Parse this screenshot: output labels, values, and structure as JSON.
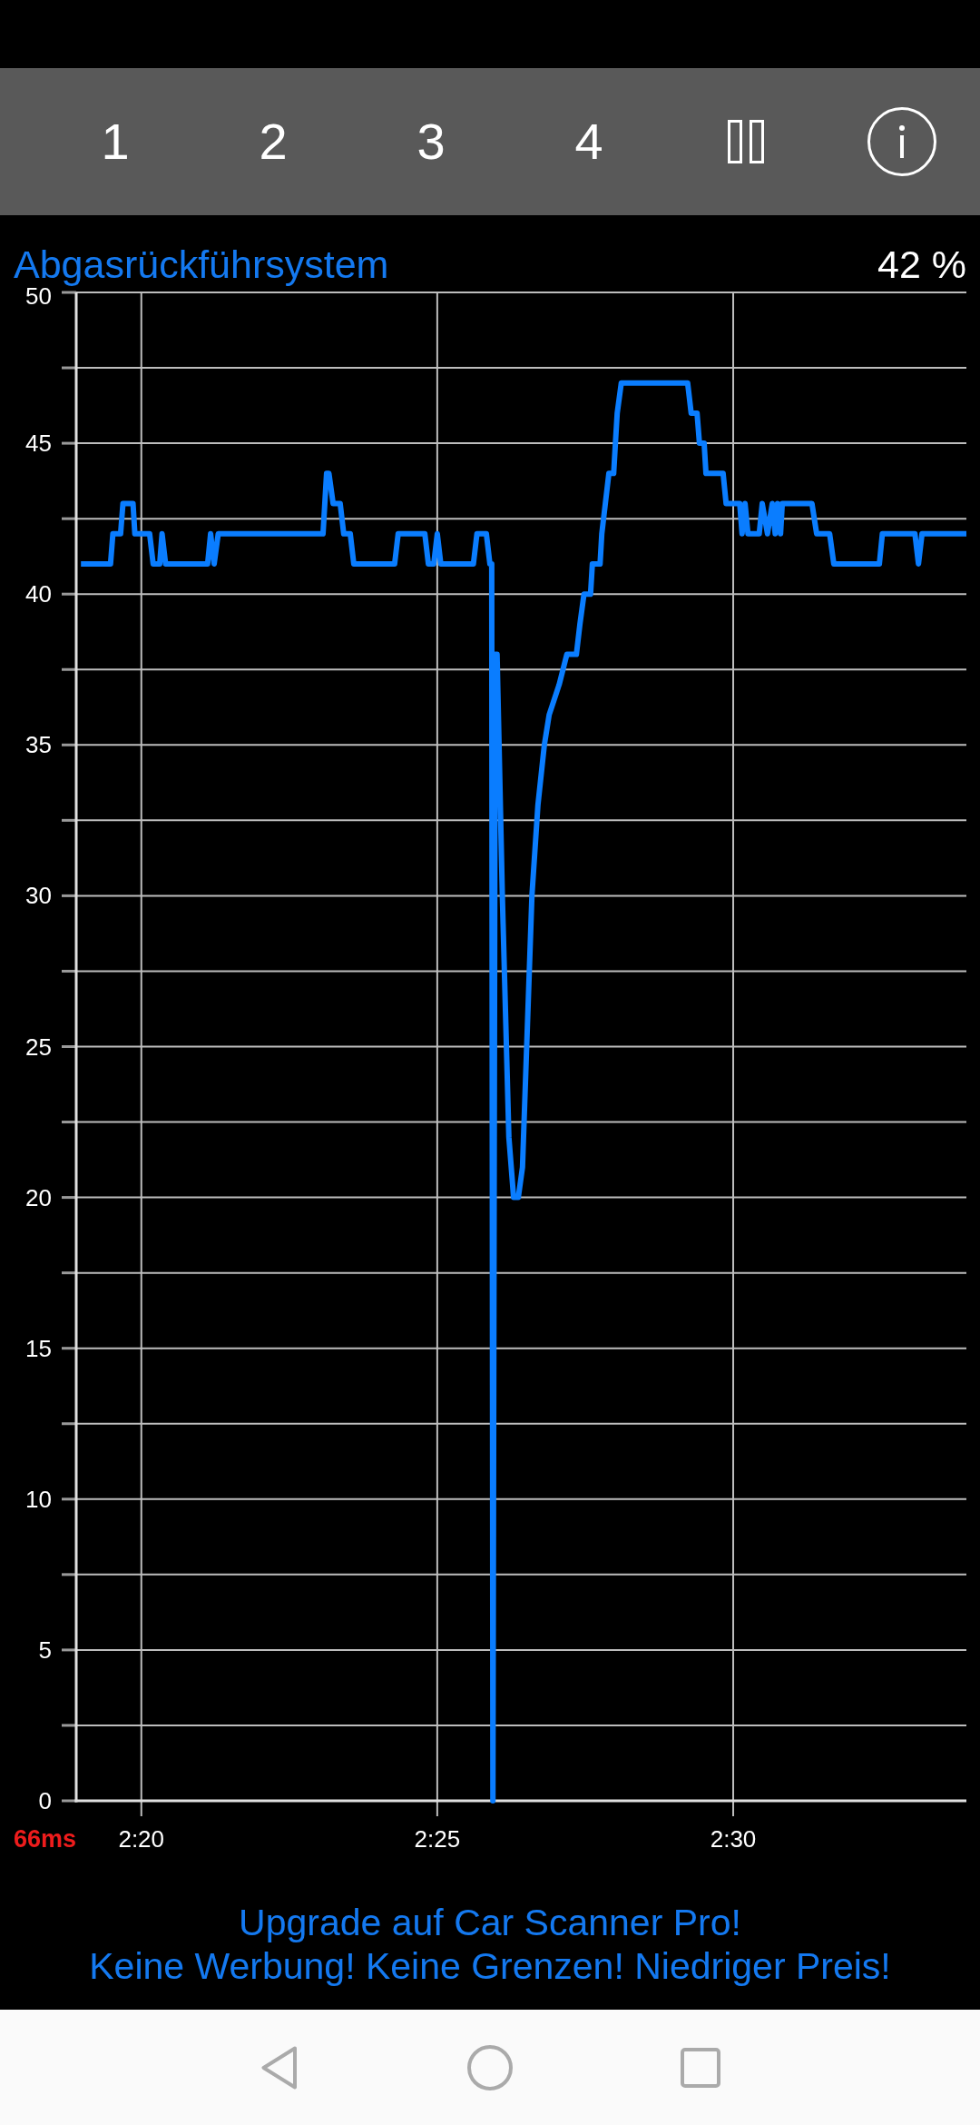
{
  "toolbar": {
    "tabs": [
      {
        "label": "1"
      },
      {
        "label": "2"
      },
      {
        "label": "3"
      },
      {
        "label": "4"
      }
    ]
  },
  "sensor": {
    "name": "Abgasrückführsystem",
    "value": "42 %"
  },
  "chart": {
    "latency": "66ms",
    "chart_data": {
      "type": "line",
      "grid": true,
      "x": [
        138.98,
        139.48,
        139.52,
        139.65,
        139.69,
        139.86,
        139.89,
        140.14,
        140.2,
        140.31,
        140.35,
        140.41,
        141.12,
        141.17,
        141.23,
        141.3,
        143.07,
        143.13,
        143.17,
        143.24,
        143.36,
        143.42,
        143.53,
        143.59,
        144.28,
        144.34,
        144.79,
        144.85,
        144.94,
        145.0,
        145.06,
        145.61,
        145.67,
        145.83,
        145.89,
        145.92,
        145.94,
        145.98,
        146.01,
        146.1,
        146.21,
        146.29,
        146.37,
        146.44,
        146.6,
        146.7,
        146.81,
        146.89,
        147.06,
        147.19,
        147.35,
        147.41,
        147.48,
        147.59,
        147.62,
        147.75,
        147.78,
        147.84,
        147.9,
        147.98,
        148.01,
        148.04,
        148.11,
        149.23,
        149.29,
        149.39,
        149.43,
        149.51,
        149.54,
        149.83,
        149.88,
        150.11,
        150.15,
        150.2,
        150.25,
        150.28,
        150.44,
        150.49,
        150.58,
        150.66,
        150.71,
        150.75,
        150.8,
        150.83,
        151.33,
        151.41,
        151.63,
        151.7,
        152.47,
        152.52,
        153.07,
        153.13,
        153.19,
        153.94
      ],
      "series": [
        {
          "color": "#0a7dff",
          "values": [
            41,
            41,
            42,
            42,
            43,
            43,
            42,
            42,
            41,
            41,
            42,
            41,
            41,
            42,
            41,
            42,
            42,
            44,
            44,
            43,
            43,
            42,
            42,
            41,
            41,
            42,
            42,
            41,
            41,
            42,
            41,
            41,
            42,
            42,
            41,
            41,
            0,
            38,
            38,
            30,
            22,
            20,
            20,
            21,
            30,
            33,
            35,
            36,
            37,
            38,
            38,
            39,
            40,
            40,
            41,
            41,
            42,
            43,
            44,
            44,
            45,
            46,
            47,
            47,
            46,
            46,
            45,
            45,
            44,
            44,
            43,
            43,
            42,
            43,
            42,
            42,
            42,
            43,
            42,
            43,
            42,
            43,
            42,
            43,
            43,
            42,
            42,
            41,
            41,
            42,
            42,
            41,
            42,
            42
          ]
        }
      ],
      "xlim": [
        138.9,
        153.94
      ],
      "ylim": [
        0,
        50
      ],
      "xticks": [
        {
          "value": 140,
          "label": "2:20"
        },
        {
          "value": 145,
          "label": "2:25"
        },
        {
          "value": 150,
          "label": "2:30"
        }
      ],
      "yticks": [
        0,
        5,
        10,
        15,
        20,
        25,
        30,
        35,
        40,
        45,
        50
      ]
    }
  },
  "upgrade_banner": {
    "lines": [
      "Upgrade auf Car Scanner Pro!",
      "Keine Werbung! Keine Grenzen! Niedriger Preis!"
    ]
  }
}
